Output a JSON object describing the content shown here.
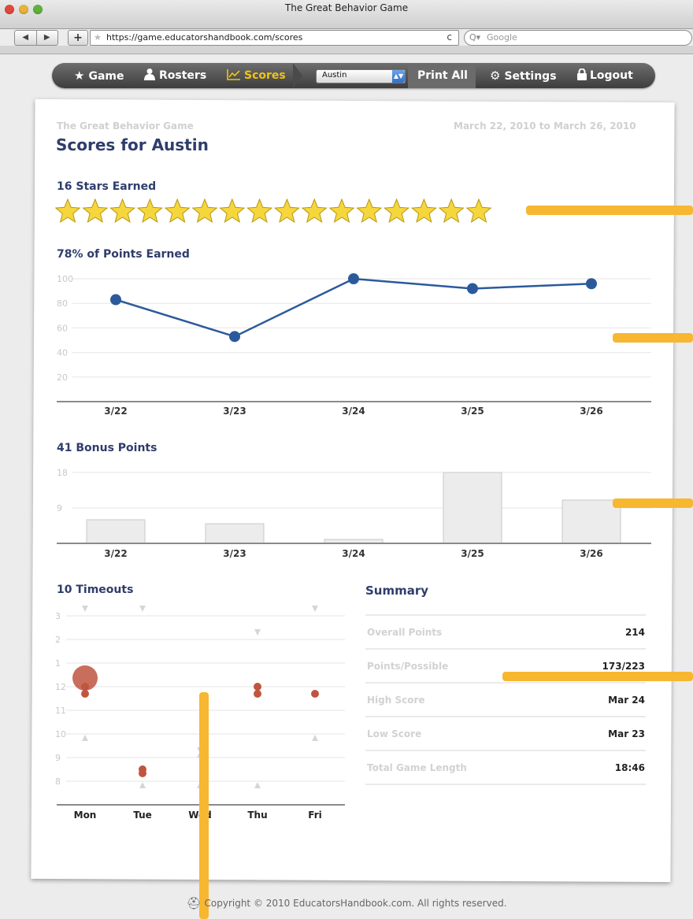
{
  "browser": {
    "window_title": "The Great Behavior Game",
    "back_icon": "◀",
    "forward_icon": "▶",
    "add_icon": "+",
    "url": "https://game.educatorshandbook.com/scores",
    "reload_icon": "c",
    "search_prefix": "Q▾",
    "search_placeholder": "Google"
  },
  "nav": {
    "game": "Game",
    "rosters": "Rosters",
    "scores": "Scores",
    "class_select": "Austin",
    "print_all": "Print All",
    "settings": "Settings",
    "logout": "Logout"
  },
  "report": {
    "app_name": "The Great Behavior Game",
    "date_range": "March 22, 2010 to March 26, 2010",
    "title": "Scores for Austin"
  },
  "stars": {
    "heading": "16 Stars Earned",
    "count": 16
  },
  "chart_data": [
    {
      "type": "line",
      "title": "78% of Points Earned",
      "categories": [
        "3/22",
        "3/23",
        "3/24",
        "3/25",
        "3/26"
      ],
      "values": [
        83,
        53,
        100,
        92,
        96
      ],
      "yticks": [
        "100",
        "80",
        "60",
        "40",
        "20"
      ],
      "ylim": [
        0,
        100
      ],
      "color": "#2b5a9c"
    },
    {
      "type": "bar",
      "title": "41 Bonus Points",
      "categories": [
        "3/22",
        "3/23",
        "3/24",
        "3/25",
        "3/26"
      ],
      "values": [
        6,
        5,
        1,
        18,
        11
      ],
      "yticks": [
        "18",
        "9"
      ],
      "ylim": [
        0,
        18
      ],
      "color": "#ececec"
    },
    {
      "type": "scatter",
      "title": "10 Timeouts",
      "categories": [
        "Mon",
        "Tue",
        "Wed",
        "Thu",
        "Fri"
      ],
      "yticks": [
        "3",
        "2",
        "1",
        "12",
        "11",
        "10",
        "9",
        "8"
      ],
      "color": "#c0553f"
    }
  ],
  "summary": {
    "heading": "Summary",
    "rows": [
      {
        "label": "Overall Points",
        "value": "214"
      },
      {
        "label": "Points/Possible",
        "value": "173/223"
      },
      {
        "label": "High Score",
        "value": "Mar 24"
      },
      {
        "label": "Low Score",
        "value": "Mar 23"
      },
      {
        "label": "Total Game Length",
        "value": "18:46"
      }
    ]
  },
  "footer": {
    "text": "Copyright © 2010 EducatorsHandbook.com. All rights reserved."
  },
  "colors": {
    "accent": "#f1c40f",
    "heading": "#2e3d6b",
    "line": "#2b5a9c",
    "highlight": "#f7b731",
    "timeout": "#c0553f"
  }
}
